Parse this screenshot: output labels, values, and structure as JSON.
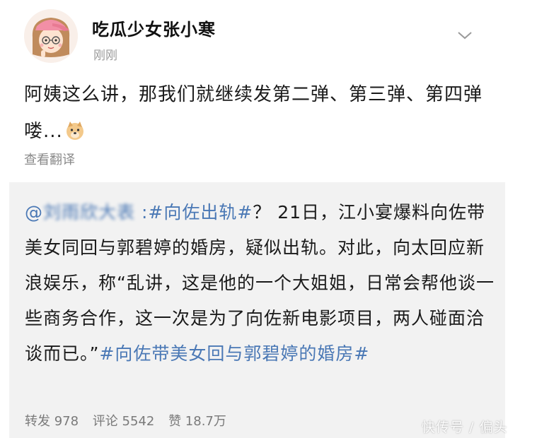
{
  "author": {
    "name": "吃瓜少女张小寒",
    "time": "刚刚"
  },
  "post": {
    "text": "阿姨这么讲，那我们就继续发第二弹、第三弹、第四弹喽...",
    "translate_label": "查看翻译"
  },
  "repost": {
    "mention_prefix": "@",
    "mention_name": "刘雨欣大表",
    "mention_colon": " :",
    "topic1": "#向佐出轨#",
    "body": "？ 21日，江小宴爆料向佐带美女同回与郭碧婷的婚房，疑似出轨。对此，向太回应新浪娱乐，称“乱讲，这是他的一个大姐姐，日常会帮他谈一些商务合作，这一次是为了向佐新电影项目，两人碰面洽谈而已。”",
    "topic2": "#向佐带美女回与郭碧婷的婚房#",
    "stats": {
      "repost": "转发 978",
      "comment": "评论 5542",
      "like": "赞 18.7万"
    }
  },
  "watermark": "快传号 / 偏头"
}
